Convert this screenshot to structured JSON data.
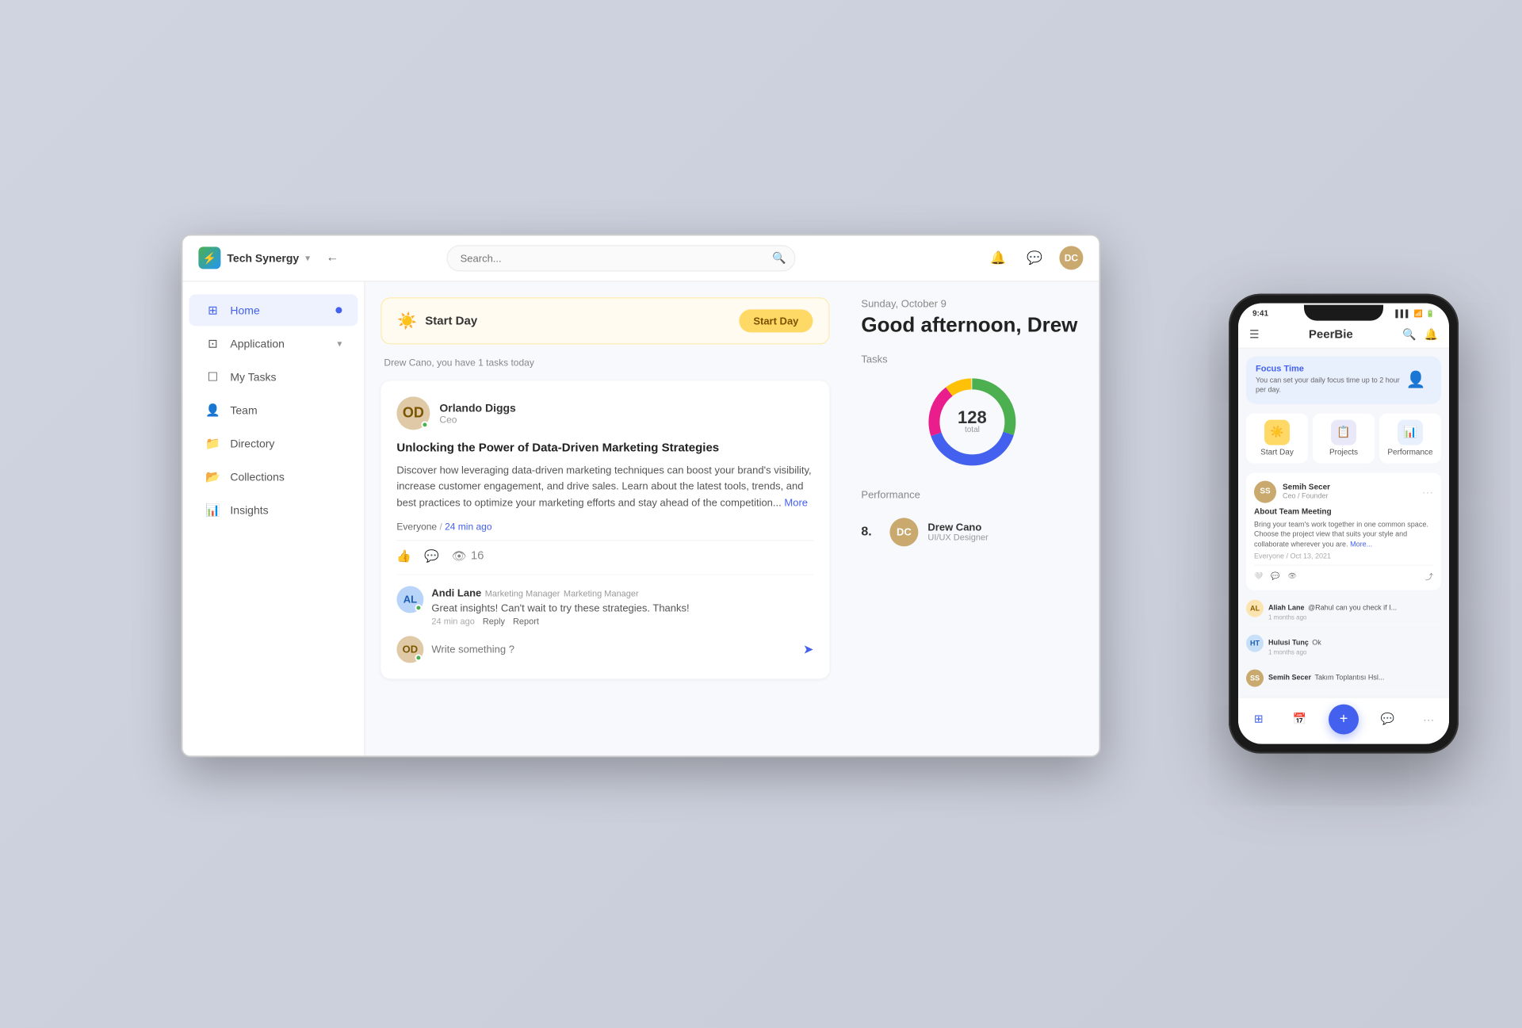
{
  "brand": {
    "name": "Tech Synergy",
    "icon": "⚡"
  },
  "header": {
    "search_placeholder": "Search...",
    "search_comma": ",",
    "back_icon": "←",
    "bell_icon": "🔔",
    "chat_icon": "💬"
  },
  "sidebar": {
    "items": [
      {
        "id": "home",
        "label": "Home",
        "icon": "⊞",
        "active": true
      },
      {
        "id": "application",
        "label": "Application",
        "icon": "⊡",
        "has_chevron": true
      },
      {
        "id": "my-tasks",
        "label": "My Tasks",
        "icon": "☐"
      },
      {
        "id": "team",
        "label": "Team",
        "icon": "👤"
      },
      {
        "id": "directory",
        "label": "Directory",
        "icon": "📁"
      },
      {
        "id": "collections",
        "label": "Collections",
        "icon": "📂"
      },
      {
        "id": "insights",
        "label": "Insights",
        "icon": "📊"
      }
    ]
  },
  "start_day": {
    "emoji": "☀️",
    "title": "Start Day",
    "button_label": "Start Day",
    "tasks_text": "Drew Cano, you have 1 tasks today"
  },
  "post": {
    "author": {
      "name": "Orlando Diggs",
      "role": "Ceo",
      "initials": "OD"
    },
    "title": "Unlocking the Power of Data-Driven Marketing Strategies",
    "body": "Discover how leveraging data-driven marketing techniques can boost your brand's visibility, increase customer engagement, and drive sales. Learn about the latest tools, trends, and best practices to optimize your marketing efforts and stay ahead of the competition...",
    "more_label": "More",
    "meta": "Everyone / 24 min ago",
    "audience": "Everyone",
    "time": "24 min ago",
    "actions": {
      "like_icon": "👍",
      "comment_icon": "💬",
      "view_icon": "👁",
      "view_count": "16"
    },
    "comment": {
      "author": "Andi Lane",
      "role": "Marketing Manager",
      "text": "Great insights! Can't wait to try these strategies. Thanks!",
      "time": "24 min ago",
      "reply_label": "Reply",
      "report_label": "Report",
      "initials": "AL"
    },
    "comment_input_placeholder": "Write something ?"
  },
  "right_panel": {
    "date": "Sunday, October 9",
    "greeting": "Good afternoon, Drew",
    "tasks_label": "Tasks",
    "total_tasks": "128",
    "total_label": "total",
    "performance_label": "Performance",
    "performer": {
      "rank": "8.",
      "name": "Drew Cano",
      "role": "UI/UX Designer",
      "initials": "DC"
    }
  },
  "phone": {
    "status_time": "9:41",
    "app_name": "PeerBie",
    "focus_time_title": "Focus Time",
    "focus_time_desc": "You can set your daily focus time up to 2 hour per day.",
    "quick_actions": [
      {
        "label": "Start Day",
        "icon": "☀️",
        "class": "qa-start"
      },
      {
        "label": "Projects",
        "icon": "📋",
        "class": "qa-projects"
      },
      {
        "label": "Performance",
        "icon": "📊",
        "class": "qa-performance"
      }
    ],
    "post": {
      "author": "Semih Secer",
      "role": "Ceo / Founder",
      "title": "About Team Meeting",
      "body": "Bring your team's work together in one common space. Choose the project view that suits your style and collaborate wherever you are.",
      "more_label": "More...",
      "meta": "Everyone / Oct 13, 2021"
    },
    "comments": [
      {
        "name": "Aliah Lane",
        "text": "@Rahul can you check if I...",
        "time": "1 months ago",
        "bg": "#fce4b0",
        "color": "#8b5e00"
      },
      {
        "name": "Hulusi Tunç",
        "text": "Ok",
        "time": "1 months ago",
        "bg": "#c8dff8",
        "color": "#1a5fb4"
      },
      {
        "name": "Semih Secer",
        "text": "Takım Toplantısı Hsl...",
        "time": "",
        "bg": "#c9a96e",
        "color": "#fff"
      }
    ]
  }
}
